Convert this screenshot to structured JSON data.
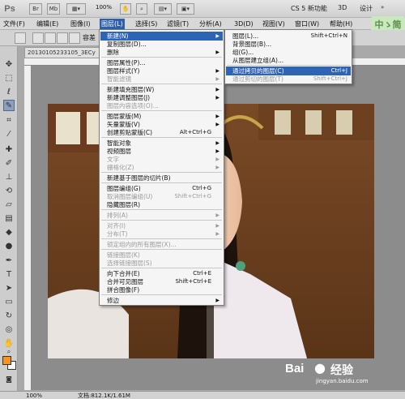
{
  "app": {
    "logo": "Ps",
    "toolbar": {
      "br": "Br",
      "mb": "Mb",
      "zoom": "100%"
    },
    "workspace": {
      "cs5": "CS 5 新功能",
      "three_d": "3D",
      "design": "设计"
    }
  },
  "menubar": {
    "items": [
      "文件(F)",
      "编辑(E)",
      "图像(I)",
      "图层(L)",
      "选择(S)",
      "滤镜(T)",
      "分析(A)",
      "3D(D)",
      "视图(V)",
      "窗口(W)",
      "帮助(H)"
    ],
    "active_index": 3,
    "badge": "中ゝ简"
  },
  "optionsbar": {
    "label": "容差"
  },
  "document": {
    "tab_title": "20130105233105_3ECy",
    "zoom": "100%",
    "status": "文档:812.1K/1.61M"
  },
  "layer_menu": {
    "items": [
      {
        "label": "新建(N)",
        "shortcut": "",
        "submenu": true,
        "disabled": false,
        "highlighted": true
      },
      {
        "label": "复制图层(D)...",
        "shortcut": "",
        "submenu": false,
        "disabled": false
      },
      {
        "label": "删除",
        "shortcut": "",
        "submenu": true,
        "disabled": false
      },
      {
        "sep": true
      },
      {
        "label": "图层属性(P)...",
        "shortcut": "",
        "submenu": false,
        "disabled": false
      },
      {
        "label": "图层样式(Y)",
        "shortcut": "",
        "submenu": true,
        "disabled": false
      },
      {
        "label": "智能滤镜",
        "shortcut": "",
        "submenu": true,
        "disabled": true
      },
      {
        "sep": true
      },
      {
        "label": "新建填充图层(W)",
        "shortcut": "",
        "submenu": true,
        "disabled": false
      },
      {
        "label": "新建调整图层(J)",
        "shortcut": "",
        "submenu": true,
        "disabled": false
      },
      {
        "label": "图层内容选项(O)...",
        "shortcut": "",
        "submenu": false,
        "disabled": true
      },
      {
        "sep": true
      },
      {
        "label": "图层蒙版(M)",
        "shortcut": "",
        "submenu": true,
        "disabled": false
      },
      {
        "label": "矢量蒙版(V)",
        "shortcut": "",
        "submenu": true,
        "disabled": false
      },
      {
        "label": "创建剪贴蒙版(C)",
        "shortcut": "Alt+Ctrl+G",
        "submenu": false,
        "disabled": false
      },
      {
        "sep": true
      },
      {
        "label": "智能对象",
        "shortcut": "",
        "submenu": true,
        "disabled": false
      },
      {
        "label": "视频图层",
        "shortcut": "",
        "submenu": true,
        "disabled": false
      },
      {
        "label": "文字",
        "shortcut": "",
        "submenu": true,
        "disabled": true
      },
      {
        "label": "栅格化(Z)",
        "shortcut": "",
        "submenu": true,
        "disabled": true
      },
      {
        "sep": true
      },
      {
        "label": "新建基于图层的切片(B)",
        "shortcut": "",
        "submenu": false,
        "disabled": false
      },
      {
        "sep": true
      },
      {
        "label": "图层编组(G)",
        "shortcut": "Ctrl+G",
        "submenu": false,
        "disabled": false
      },
      {
        "label": "取消图层编组(U)",
        "shortcut": "Shift+Ctrl+G",
        "submenu": false,
        "disabled": true
      },
      {
        "label": "隐藏图层(R)",
        "shortcut": "",
        "submenu": false,
        "disabled": false
      },
      {
        "sep": true
      },
      {
        "label": "排列(A)",
        "shortcut": "",
        "submenu": true,
        "disabled": true
      },
      {
        "sep": true
      },
      {
        "label": "对齐(I)",
        "shortcut": "",
        "submenu": true,
        "disabled": true
      },
      {
        "label": "分布(T)",
        "shortcut": "",
        "submenu": true,
        "disabled": true
      },
      {
        "sep": true
      },
      {
        "label": "锁定组内的所有图层(X)...",
        "shortcut": "",
        "submenu": false,
        "disabled": true
      },
      {
        "sep": true
      },
      {
        "label": "链接图层(K)",
        "shortcut": "",
        "submenu": false,
        "disabled": true
      },
      {
        "label": "选择链接图层(S)",
        "shortcut": "",
        "submenu": false,
        "disabled": true
      },
      {
        "sep": true
      },
      {
        "label": "向下合并(E)",
        "shortcut": "Ctrl+E",
        "submenu": false,
        "disabled": false
      },
      {
        "label": "合并可见图层",
        "shortcut": "Shift+Ctrl+E",
        "submenu": false,
        "disabled": false
      },
      {
        "label": "拼合图像(F)",
        "shortcut": "",
        "submenu": false,
        "disabled": false
      },
      {
        "sep": true
      },
      {
        "label": "修边",
        "shortcut": "",
        "submenu": true,
        "disabled": false
      }
    ]
  },
  "new_submenu": {
    "items": [
      {
        "label": "图层(L)...",
        "shortcut": "Shift+Ctrl+N",
        "disabled": false
      },
      {
        "label": "背景图层(B)...",
        "shortcut": "",
        "disabled": false
      },
      {
        "label": "组(G)...",
        "shortcut": "",
        "disabled": false
      },
      {
        "label": "从图层建立组(A)...",
        "shortcut": "",
        "disabled": false
      },
      {
        "sep": true
      },
      {
        "label": "通过拷贝的图层(C)",
        "shortcut": "Ctrl+J",
        "disabled": false,
        "highlighted": true
      },
      {
        "label": "通过剪切的图层(T)",
        "shortcut": "Shift+Ctrl+J",
        "disabled": true
      }
    ]
  },
  "watermark": {
    "brand": "Bai",
    "brand2": "经验",
    "url": "jingyan.baidu.com"
  }
}
